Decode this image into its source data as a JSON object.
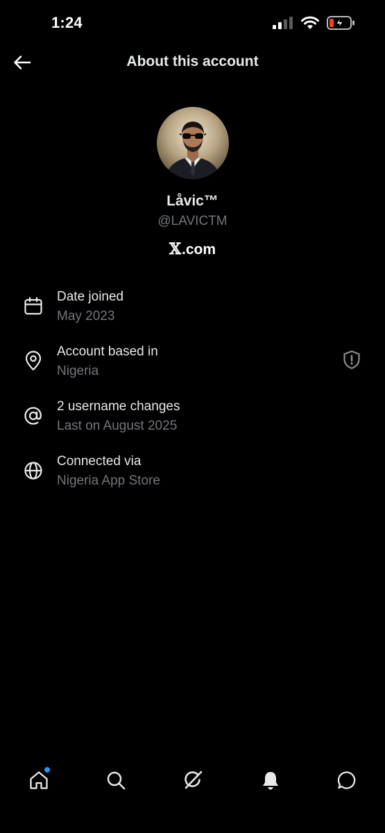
{
  "status_bar": {
    "time": "1:24",
    "icons": [
      "cellular-signal-icon",
      "wifi-icon",
      "battery-charging-icon"
    ],
    "battery_color": "#ff3b30"
  },
  "header": {
    "back_icon": "arrow-left-icon",
    "title": "About this account"
  },
  "profile": {
    "display_name": "Låvic™",
    "handle": "@LAVICTM",
    "site_logo": "𝕏",
    "site_suffix": ".com"
  },
  "info": [
    {
      "icon": "calendar-icon",
      "title": "Date joined",
      "value": "May 2023"
    },
    {
      "icon": "location-pin-icon",
      "title": "Account based in",
      "value": "Nigeria",
      "trailing_icon": "shield-alert-icon"
    },
    {
      "icon": "at-sign-icon",
      "title": "2 username changes",
      "value": "Last on August 2025"
    },
    {
      "icon": "globe-icon",
      "title": "Connected via",
      "value": "Nigeria App Store"
    }
  ],
  "tab_bar": {
    "tabs": [
      "home-icon",
      "search-icon",
      "grok-icon",
      "notifications-bell-icon",
      "messages-icon"
    ],
    "active": "home-icon",
    "badge_color": "#1d9bf0"
  },
  "colors": {
    "background": "#000000",
    "primary_text": "#e7e9ea",
    "secondary_text": "#71767b",
    "accent": "#1d9bf0"
  }
}
